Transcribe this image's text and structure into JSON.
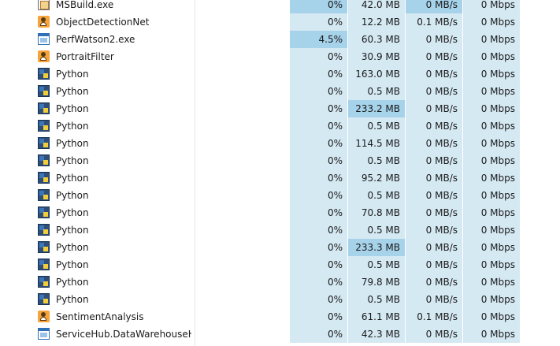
{
  "rows": [
    {
      "name": "MSBuild.exe",
      "icon": "msbuild-icon",
      "cpu": "0%",
      "memory": "42.0 MB",
      "disk": "0 MB/s",
      "network": "0 Mbps",
      "heat": {
        "cpu": 1,
        "memory": 0,
        "disk": 1,
        "network": 0
      }
    },
    {
      "name": "ObjectDetectionNet",
      "icon": "portrait-app-icon",
      "cpu": "0%",
      "memory": "12.2 MB",
      "disk": "0.1 MB/s",
      "network": "0 Mbps",
      "heat": {
        "cpu": 0,
        "memory": 0,
        "disk": 0,
        "network": 0
      }
    },
    {
      "name": "PerfWatson2.exe",
      "icon": "window-app-icon",
      "cpu": "4.5%",
      "memory": "60.3 MB",
      "disk": "0 MB/s",
      "network": "0 Mbps",
      "heat": {
        "cpu": 1,
        "memory": 0,
        "disk": 0,
        "network": 0
      }
    },
    {
      "name": "PortraitFilter",
      "icon": "portrait-app-icon",
      "cpu": "0%",
      "memory": "30.9 MB",
      "disk": "0 MB/s",
      "network": "0 Mbps",
      "heat": {
        "cpu": 0,
        "memory": 0,
        "disk": 0,
        "network": 0
      }
    },
    {
      "name": "Python",
      "icon": "python-icon",
      "cpu": "0%",
      "memory": "163.0 MB",
      "disk": "0 MB/s",
      "network": "0 Mbps",
      "heat": {
        "cpu": 0,
        "memory": 0,
        "disk": 0,
        "network": 0
      }
    },
    {
      "name": "Python",
      "icon": "python-icon",
      "cpu": "0%",
      "memory": "0.5 MB",
      "disk": "0 MB/s",
      "network": "0 Mbps",
      "heat": {
        "cpu": 0,
        "memory": 0,
        "disk": 0,
        "network": 0
      }
    },
    {
      "name": "Python",
      "icon": "python-icon",
      "cpu": "0%",
      "memory": "233.2 MB",
      "disk": "0 MB/s",
      "network": "0 Mbps",
      "heat": {
        "cpu": 0,
        "memory": 1,
        "disk": 0,
        "network": 0
      }
    },
    {
      "name": "Python",
      "icon": "python-icon",
      "cpu": "0%",
      "memory": "0.5 MB",
      "disk": "0 MB/s",
      "network": "0 Mbps",
      "heat": {
        "cpu": 0,
        "memory": 0,
        "disk": 0,
        "network": 0
      }
    },
    {
      "name": "Python",
      "icon": "python-icon",
      "cpu": "0%",
      "memory": "114.5 MB",
      "disk": "0 MB/s",
      "network": "0 Mbps",
      "heat": {
        "cpu": 0,
        "memory": 0,
        "disk": 0,
        "network": 0
      }
    },
    {
      "name": "Python",
      "icon": "python-icon",
      "cpu": "0%",
      "memory": "0.5 MB",
      "disk": "0 MB/s",
      "network": "0 Mbps",
      "heat": {
        "cpu": 0,
        "memory": 0,
        "disk": 0,
        "network": 0
      }
    },
    {
      "name": "Python",
      "icon": "python-icon",
      "cpu": "0%",
      "memory": "95.2 MB",
      "disk": "0 MB/s",
      "network": "0 Mbps",
      "heat": {
        "cpu": 0,
        "memory": 0,
        "disk": 0,
        "network": 0
      }
    },
    {
      "name": "Python",
      "icon": "python-icon",
      "cpu": "0%",
      "memory": "0.5 MB",
      "disk": "0 MB/s",
      "network": "0 Mbps",
      "heat": {
        "cpu": 0,
        "memory": 0,
        "disk": 0,
        "network": 0
      }
    },
    {
      "name": "Python",
      "icon": "python-icon",
      "cpu": "0%",
      "memory": "70.8 MB",
      "disk": "0 MB/s",
      "network": "0 Mbps",
      "heat": {
        "cpu": 0,
        "memory": 0,
        "disk": 0,
        "network": 0
      }
    },
    {
      "name": "Python",
      "icon": "python-icon",
      "cpu": "0%",
      "memory": "0.5 MB",
      "disk": "0 MB/s",
      "network": "0 Mbps",
      "heat": {
        "cpu": 0,
        "memory": 0,
        "disk": 0,
        "network": 0
      }
    },
    {
      "name": "Python",
      "icon": "python-icon",
      "cpu": "0%",
      "memory": "233.3 MB",
      "disk": "0 MB/s",
      "network": "0 Mbps",
      "heat": {
        "cpu": 0,
        "memory": 1,
        "disk": 0,
        "network": 0
      }
    },
    {
      "name": "Python",
      "icon": "python-icon",
      "cpu": "0%",
      "memory": "0.5 MB",
      "disk": "0 MB/s",
      "network": "0 Mbps",
      "heat": {
        "cpu": 0,
        "memory": 0,
        "disk": 0,
        "network": 0
      }
    },
    {
      "name": "Python",
      "icon": "python-icon",
      "cpu": "0%",
      "memory": "79.8 MB",
      "disk": "0 MB/s",
      "network": "0 Mbps",
      "heat": {
        "cpu": 0,
        "memory": 0,
        "disk": 0,
        "network": 0
      }
    },
    {
      "name": "Python",
      "icon": "python-icon",
      "cpu": "0%",
      "memory": "0.5 MB",
      "disk": "0 MB/s",
      "network": "0 Mbps",
      "heat": {
        "cpu": 0,
        "memory": 0,
        "disk": 0,
        "network": 0
      }
    },
    {
      "name": "SentimentAnalysis",
      "icon": "portrait-app-icon",
      "cpu": "0%",
      "memory": "61.1 MB",
      "disk": "0.1 MB/s",
      "network": "0 Mbps",
      "heat": {
        "cpu": 0,
        "memory": 0,
        "disk": 0,
        "network": 0
      }
    },
    {
      "name": "ServiceHub.DataWarehouseH...",
      "icon": "window-app-icon",
      "cpu": "0%",
      "memory": "42.3 MB",
      "disk": "0 MB/s",
      "network": "0 Mbps",
      "heat": {
        "cpu": 0,
        "memory": 0,
        "disk": 0,
        "network": 0
      }
    }
  ],
  "colors": {
    "heat_low": "#d5e9f3",
    "heat_high": "#a6d2ea"
  }
}
